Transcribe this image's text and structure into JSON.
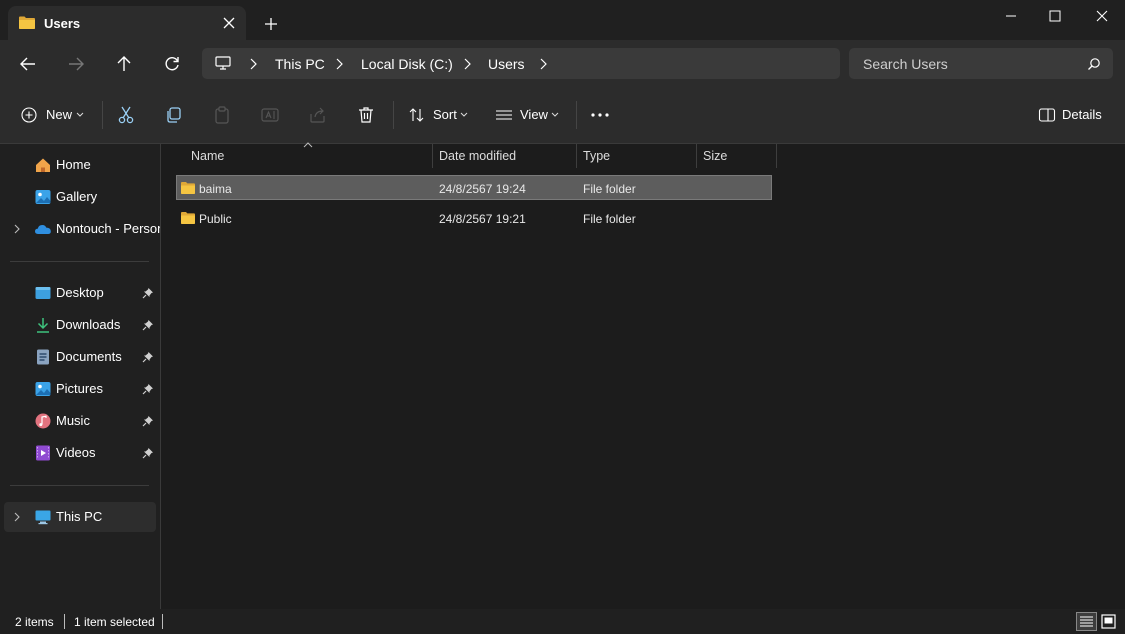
{
  "window": {
    "tab_title": "Users",
    "colors": {
      "accent_folder": "#f2c94c",
      "selection": "#5d5d5d",
      "background": "#1c1c1c"
    }
  },
  "nav": {
    "breadcrumbs": [
      "This PC",
      "Local Disk (C:)",
      "Users"
    ],
    "search_placeholder": "Search Users"
  },
  "toolbar": {
    "new_label": "New",
    "sort_label": "Sort",
    "view_label": "View",
    "details_label": "Details"
  },
  "sidebar": {
    "top_items": [
      {
        "label": "Home",
        "icon": "home-icon"
      },
      {
        "label": "Gallery",
        "icon": "gallery-icon"
      },
      {
        "label": "Nontouch - Person",
        "icon": "onedrive-icon"
      }
    ],
    "pinned_items": [
      {
        "label": "Desktop",
        "icon": "desktop-folder-icon"
      },
      {
        "label": "Downloads",
        "icon": "downloads-icon"
      },
      {
        "label": "Documents",
        "icon": "documents-icon"
      },
      {
        "label": "Pictures",
        "icon": "pictures-icon"
      },
      {
        "label": "Music",
        "icon": "music-icon"
      },
      {
        "label": "Videos",
        "icon": "videos-icon"
      }
    ],
    "this_pc_label": "This PC"
  },
  "file_list": {
    "columns": [
      "Name",
      "Date modified",
      "Type",
      "Size"
    ],
    "rows": [
      {
        "name": "baima",
        "date_modified": "24/8/2567 19:24",
        "type": "File folder",
        "size": "",
        "selected": true
      },
      {
        "name": "Public",
        "date_modified": "24/8/2567 19:21",
        "type": "File folder",
        "size": "",
        "selected": false
      }
    ]
  },
  "status": {
    "item_count": "2 items",
    "selection": "1 item selected"
  }
}
